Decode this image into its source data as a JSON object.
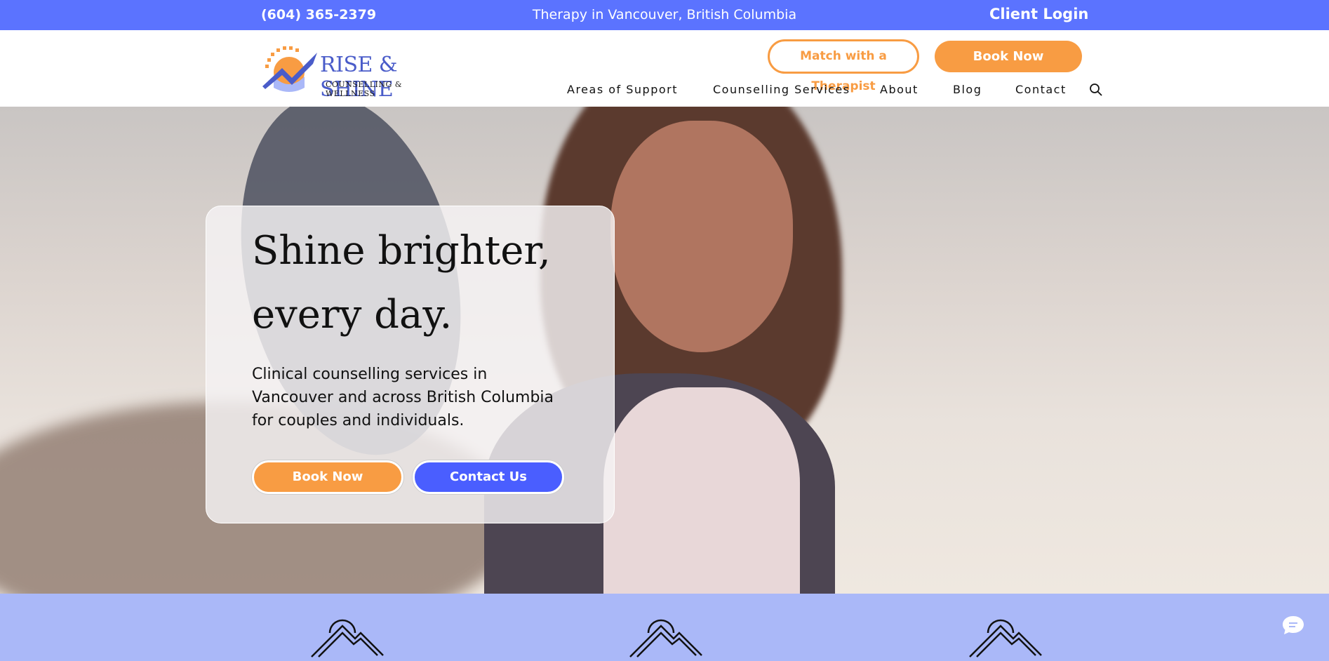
{
  "topbar": {
    "phone": "(604) 365-2379",
    "tagline": "Therapy in Vancouver, British Columbia",
    "login": "Client Login"
  },
  "logo": {
    "brand": "RISE & SHINE",
    "sub": "COUNSELLING & WELLNESS"
  },
  "header": {
    "match_label": "Match with a Therapist",
    "book_label": "Book Now"
  },
  "nav": {
    "items": [
      "Areas of Support",
      "Counselling Services",
      "About",
      "Blog",
      "Contact"
    ]
  },
  "hero": {
    "headline_line1": "Shine brighter,",
    "headline_line2": "every day.",
    "description": "Clinical counselling services in Vancouver and across British Columbia for couples and individuals.",
    "book_label": "Book Now",
    "contact_label": "Contact Us"
  },
  "colors": {
    "primary": "#5b73ff",
    "accent": "#f89c43",
    "band": "#aab8f8"
  },
  "icons": {
    "search": "search-icon",
    "mountain": "mountain-sun-icon",
    "chat": "chat-icon"
  }
}
